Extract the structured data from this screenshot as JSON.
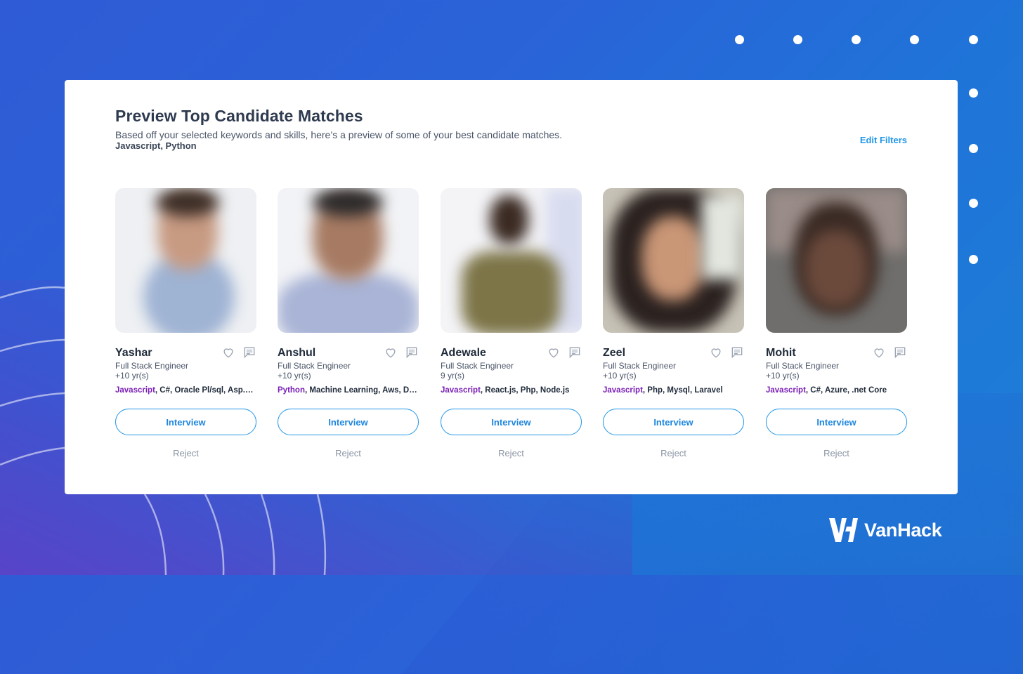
{
  "panel": {
    "title": "Preview Top Candidate Matches",
    "subtitle": "Based off your selected keywords and skills, here’s a preview of some of your best candidate matches.",
    "keywords": "Javascript, Python",
    "edit_filters_label": "Edit Filters"
  },
  "candidates": [
    {
      "name": "Yashar",
      "role": "Full Stack Engineer",
      "years": "+10 yr(s)",
      "primary_skill": "Javascript",
      "other_skills": ", C#, Oracle Pl/sql, Asp.Net",
      "interview_label": "Interview",
      "reject_label": "Reject"
    },
    {
      "name": "Anshul",
      "role": "Full Stack Engineer",
      "years": "+10 yr(s)",
      "primary_skill": "Python",
      "other_skills": ", Machine Learning, Aws, Django",
      "interview_label": "Interview",
      "reject_label": "Reject"
    },
    {
      "name": "Adewale",
      "role": "Full Stack Engineer",
      "years": "9 yr(s)",
      "primary_skill": "Javascript",
      "other_skills": ", React.js, Php, Node.js",
      "interview_label": "Interview",
      "reject_label": "Reject"
    },
    {
      "name": "Zeel",
      "role": "Full Stack Engineer",
      "years": "+10 yr(s)",
      "primary_skill": "Javascript",
      "other_skills": ", Php, Mysql, Laravel",
      "interview_label": "Interview",
      "reject_label": "Reject"
    },
    {
      "name": "Mohit",
      "role": "Full Stack Engineer",
      "years": "+10 yr(s)",
      "primary_skill": "Javascript",
      "other_skills": ", C#, Azure, .net Core",
      "interview_label": "Interview",
      "reject_label": "Reject"
    }
  ],
  "brand": {
    "name": "VanHack"
  },
  "colors": {
    "accent": "#2196e8",
    "primary_skill": "#7a1fb5",
    "title": "#2e3a4f"
  },
  "icons": [
    "heart-icon",
    "message-icon",
    "vanhack-logo-icon"
  ]
}
